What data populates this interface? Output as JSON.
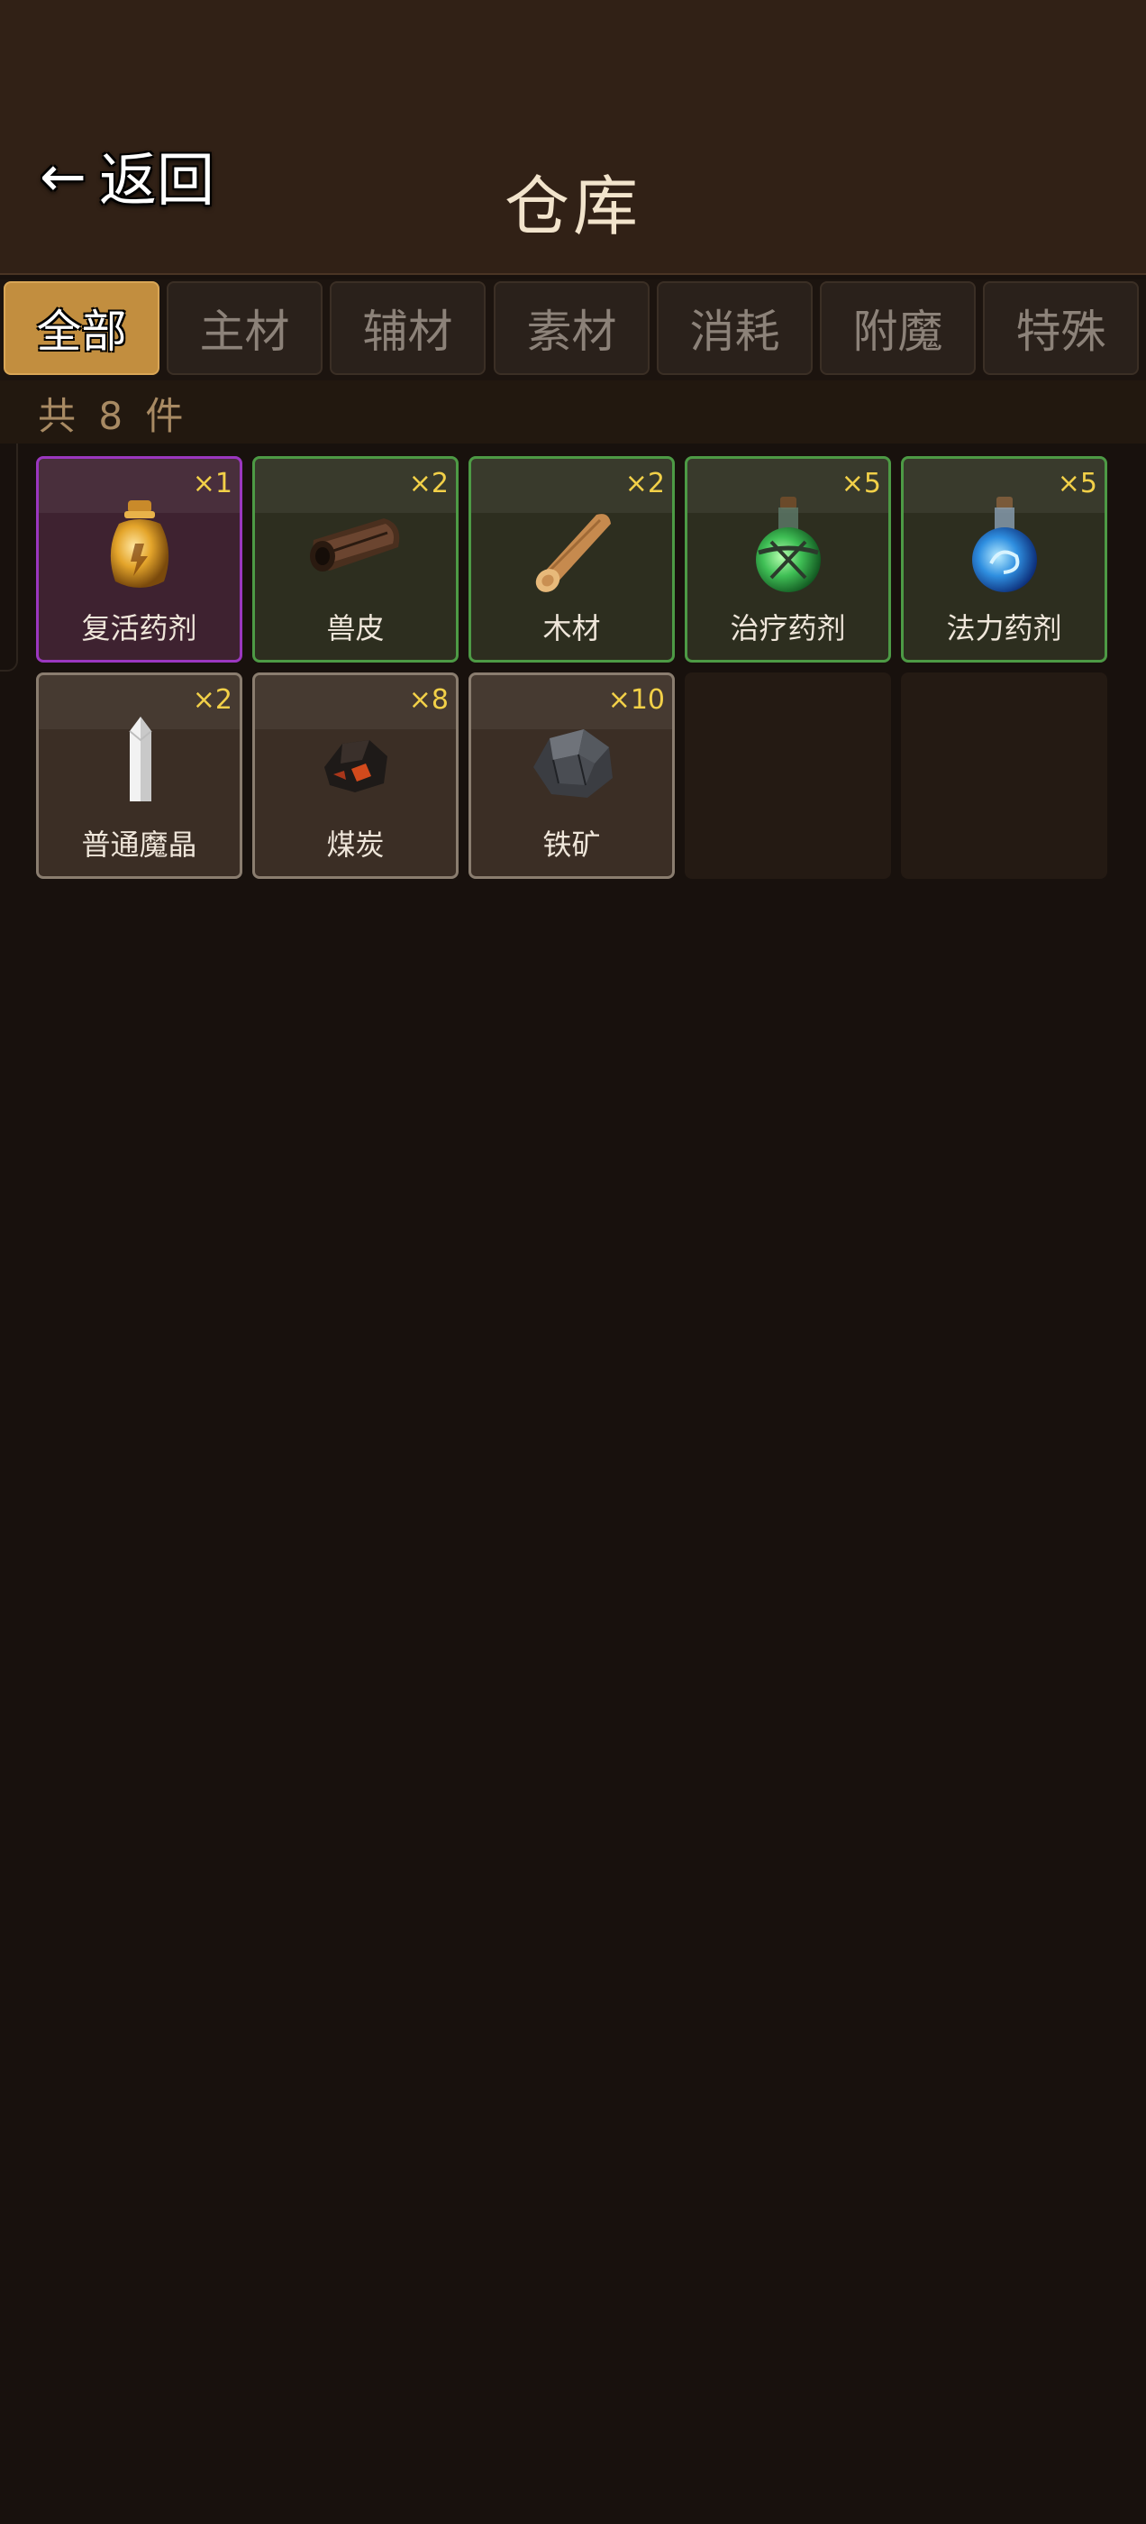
{
  "header": {
    "back_arrow": "←",
    "back_label": "返回",
    "title": "仓库"
  },
  "tabs": [
    {
      "label": "全部",
      "active": true
    },
    {
      "label": "主材",
      "active": false
    },
    {
      "label": "辅材",
      "active": false
    },
    {
      "label": "素材",
      "active": false
    },
    {
      "label": "消耗",
      "active": false
    },
    {
      "label": "附魔",
      "active": false
    },
    {
      "label": "特殊",
      "active": false
    }
  ],
  "count_text": "共 8 件",
  "items": [
    {
      "name": "复活药剂",
      "qty": "×1",
      "rarity": "purple",
      "icon": "gold-potion-icon"
    },
    {
      "name": "兽皮",
      "qty": "×2",
      "rarity": "green",
      "icon": "hide-roll-icon"
    },
    {
      "name": "木材",
      "qty": "×2",
      "rarity": "green",
      "icon": "wood-log-icon"
    },
    {
      "name": "治疗药剂",
      "qty": "×5",
      "rarity": "green",
      "icon": "green-potion-icon"
    },
    {
      "name": "法力药剂",
      "qty": "×5",
      "rarity": "green",
      "icon": "blue-potion-icon"
    },
    {
      "name": "普通魔晶",
      "qty": "×2",
      "rarity": "common",
      "icon": "crystal-icon"
    },
    {
      "name": "煤炭",
      "qty": "×8",
      "rarity": "common",
      "icon": "coal-icon"
    },
    {
      "name": "铁矿",
      "qty": "×10",
      "rarity": "common",
      "icon": "iron-ore-icon"
    }
  ],
  "colors": {
    "background": "#18110d",
    "header": "#312116",
    "active_tab": "#c28e3f",
    "purple_border": "#9b37c0",
    "green_border": "#4d9a45",
    "quantity": "#f2d048"
  }
}
